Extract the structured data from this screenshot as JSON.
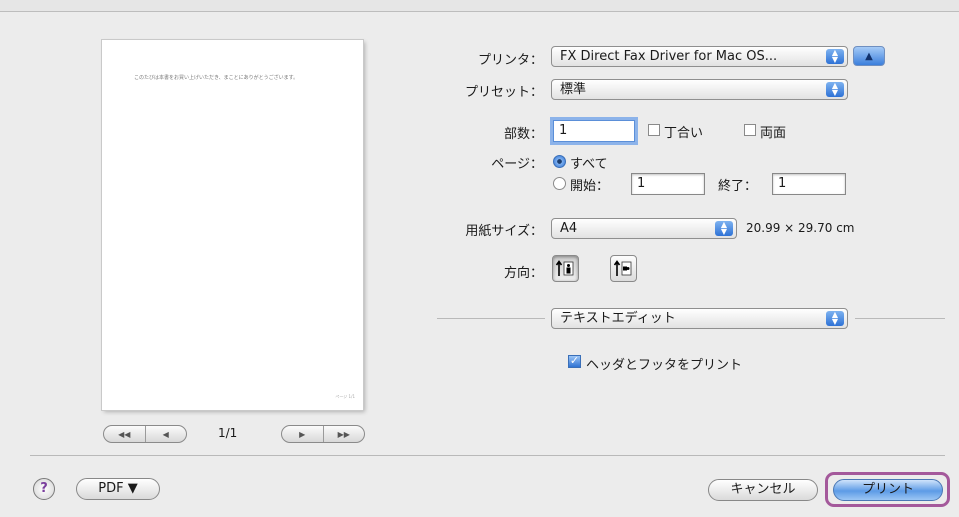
{
  "preview": {
    "sample_text": "このたびは本書をお買い上げいただき、まことにありがとうございます。",
    "footer_text": "ページ 1/1",
    "page_indicator": "1/1",
    "nav": [
      "◀◀",
      "◀",
      "▶",
      "▶▶"
    ]
  },
  "form": {
    "printer": {
      "label": "プリンタ：",
      "value": "FX Direct Fax Driver for Mac OS..."
    },
    "preset": {
      "label": "プリセット：",
      "value": "標準"
    },
    "copies": {
      "label": "部数：",
      "value": "1",
      "collate": "丁合い",
      "duplex": "両面"
    },
    "pages": {
      "label": "ページ：",
      "all": "すべて",
      "from_label": "開始：",
      "from_value": "1",
      "to_label": "終了：",
      "to_value": "1"
    },
    "paper": {
      "label": "用紙サイズ：",
      "value": "A4",
      "dimensions": "20.99 × 29.70 cm"
    },
    "orientation": {
      "label": "方向："
    },
    "app_section": {
      "value": "テキストエディット"
    },
    "header_footer": "ヘッダとフッタをプリント"
  },
  "footer": {
    "help": "?",
    "pdf": "PDF ▼",
    "cancel": "キャンセル",
    "print": "プリント"
  },
  "colors": {
    "accent": "#2f73d3",
    "highlight": "#a4599b"
  }
}
